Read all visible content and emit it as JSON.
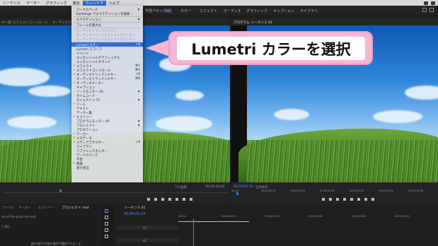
{
  "menubar": {
    "items": [
      "シーケンス",
      "マーカー",
      "グラフィック",
      "表示",
      "ウィンドウ",
      "ヘルプ"
    ]
  },
  "workspaces": [
    "学習",
    "アセンブリ",
    "編集",
    "カラー",
    "エフェクト",
    "オーディオ",
    "グラフィック",
    "キャプション",
    "ライブラリ"
  ],
  "source_panel": {
    "tabs": [
      "ソース:",
      "エフェクトコントロール",
      "オーディオクリップミキサー"
    ]
  },
  "program_panel": {
    "title": "プログラム: シーケンス 01"
  },
  "window_menu": {
    "items": [
      {
        "label": "ワークスペース",
        "submenu": true
      },
      {
        "label": "Exchange でエクステンションを検索..."
      },
      {
        "separator": true
      },
      {
        "label": "エクステンション",
        "submenu": true
      },
      {
        "separator": true
      },
      {
        "label": "フレームを最大化"
      },
      {
        "separator": true
      },
      {
        "label": "オーディオトラックミキサー",
        "disabled": true
      },
      {
        "label": "オーディオクリップエフェクトエディター",
        "disabled": true
      },
      {
        "label": "オーディオトラックエフェクトエディター",
        "disabled": true
      },
      {
        "separator": true
      },
      {
        "label": "Lumetri カラー",
        "shortcut": "⇧8",
        "highlighted": true
      },
      {
        "label": "Lumetri スコープ"
      },
      {
        "label": "イベント"
      },
      {
        "label": "エッセンシャルグラフィックス"
      },
      {
        "label": "エッセンシャルサウンド"
      },
      {
        "label": "エフェクト",
        "checked": true,
        "shortcut": "⌘7"
      },
      {
        "label": "エフェクトコントロール",
        "checked": true,
        "shortcut": "⌘5"
      },
      {
        "label": "オーディオクリップミキサー",
        "checked": true,
        "shortcut": "⇧9"
      },
      {
        "label": "オーディオトラックミキサー",
        "shortcut": "⌘6"
      },
      {
        "label": "オーディオメーター",
        "checked": true
      },
      {
        "label": "キャプション"
      },
      {
        "label": "ソースモニター (S)",
        "submenu": true
      },
      {
        "label": "タイムコード"
      },
      {
        "label": "タイムライン (T)",
        "submenu": true
      },
      {
        "label": "ツール",
        "checked": true
      },
      {
        "label": "テキスト"
      },
      {
        "label": "データ一覧"
      },
      {
        "label": "ヒストリー",
        "checked": true
      },
      {
        "label": "プログラムモニター (P)",
        "submenu": true
      },
      {
        "label": "プロジェクト",
        "submenu": true
      },
      {
        "label": "プロダクション"
      },
      {
        "label": "マーカー",
        "checked": true
      },
      {
        "label": "メタデータ",
        "checked": true
      },
      {
        "label": "メディアブラウザー",
        "checked": true,
        "shortcut": "⇧8"
      },
      {
        "label": "ライブラリ"
      },
      {
        "label": "リファレンスモニター"
      },
      {
        "label": "ワークスペース"
      },
      {
        "label": "学習"
      },
      {
        "label": "情報",
        "checked": true
      },
      {
        "label": "進行状況"
      }
    ]
  },
  "callout": {
    "text": "Lumetri カラーを選択"
  },
  "source_controls": {
    "fit": "フル画質",
    "timecode": "00;00;10;00",
    "playhead_fraction": 0.25
  },
  "program_controls": {
    "timecode": "00;00;02;10",
    "fit": "全体表示",
    "ruler_labels": [
      "00;00",
      "00;00;05;00",
      "00;00;10;00",
      "00;00;15;00",
      "00;00;20;00",
      "00;00;25;00",
      "00;00;30;00"
    ]
  },
  "bottom": {
    "tabs": [
      "ファイル",
      "マーカー",
      "ヒストリー",
      "プロジェクト: test"
    ],
    "project_file": "ion-of-the-grass-hd.mp4",
    "project_count": "1 項目",
    "status_text": "個の項目中1個の選択が選択されました",
    "timeline_tab": "シーケンス 01",
    "timeline_timecode": "00;00;02;10",
    "timeline_labels": [
      "00;00",
      "00;00;05;00",
      "00;00;10;00",
      "00;00;15;00",
      "00;00;20;00",
      "00;00;25;00"
    ],
    "tracks": [
      "V1",
      "A1"
    ]
  }
}
